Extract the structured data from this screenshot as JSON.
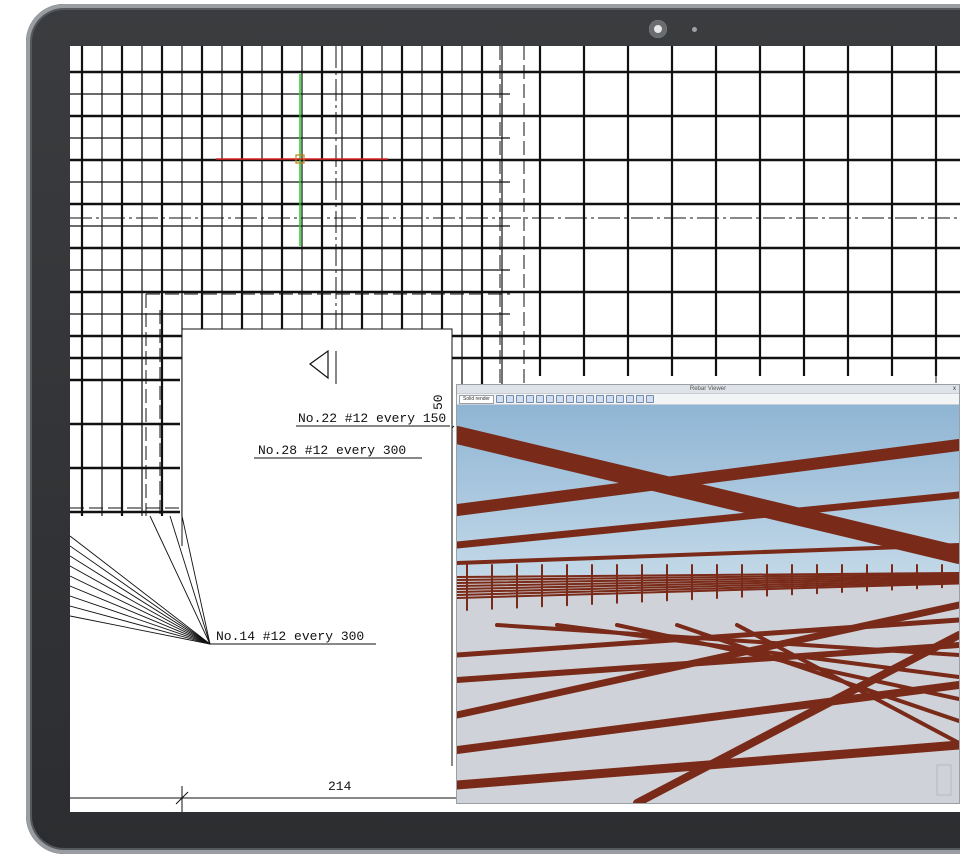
{
  "cad": {
    "annotations": [
      {
        "id": "rebar-no22",
        "text": "No.22 #12 every 150"
      },
      {
        "id": "rebar-no28",
        "text": "No.28 #12 every 300"
      },
      {
        "id": "rebar-no14",
        "text": "No.14 #12 every 300"
      }
    ],
    "dimension_value": "214",
    "vertical_dimension": "50"
  },
  "viewer": {
    "title": "Rebar Viewer",
    "mode_select": "Solid render",
    "close_label": "x",
    "colors": {
      "sky_top": "#8fb5d4",
      "sky_bottom": "#c8dcea",
      "floor": "#cfd3d9",
      "rebar": "#7a2a18"
    }
  }
}
